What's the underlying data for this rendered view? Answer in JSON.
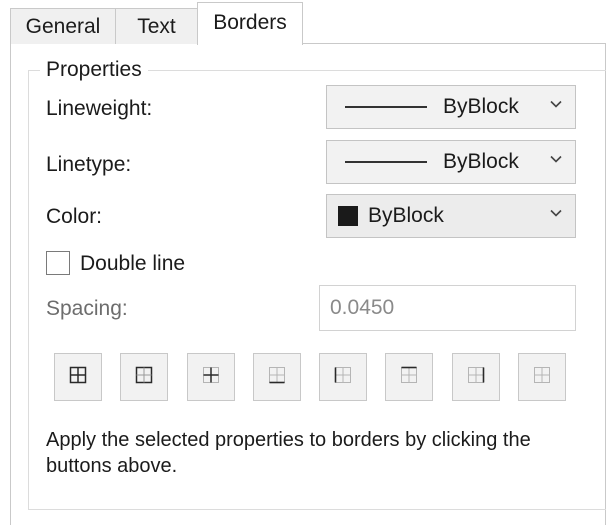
{
  "tabs": [
    {
      "label": "General"
    },
    {
      "label": "Text"
    },
    {
      "label": "Borders"
    }
  ],
  "properties": {
    "title": "Properties",
    "lineweight": {
      "label": "Lineweight:",
      "value": "ByBlock"
    },
    "linetype": {
      "label": "Linetype:",
      "value": "ByBlock"
    },
    "color": {
      "label": "Color:",
      "value": "ByBlock",
      "swatch": "#1a1a1a"
    },
    "double_line": {
      "label": "Double line",
      "checked": false
    },
    "spacing": {
      "label": "Spacing:",
      "value": "0.0450"
    }
  },
  "border_buttons": [
    {
      "icon": "all-borders-icon"
    },
    {
      "icon": "outside-borders-icon"
    },
    {
      "icon": "inside-borders-icon"
    },
    {
      "icon": "bottom-border-icon"
    },
    {
      "icon": "left-border-icon"
    },
    {
      "icon": "top-border-icon"
    },
    {
      "icon": "right-border-icon"
    },
    {
      "icon": "no-border-icon"
    }
  ],
  "help_text": "Apply the selected properties to borders by clicking the buttons above."
}
